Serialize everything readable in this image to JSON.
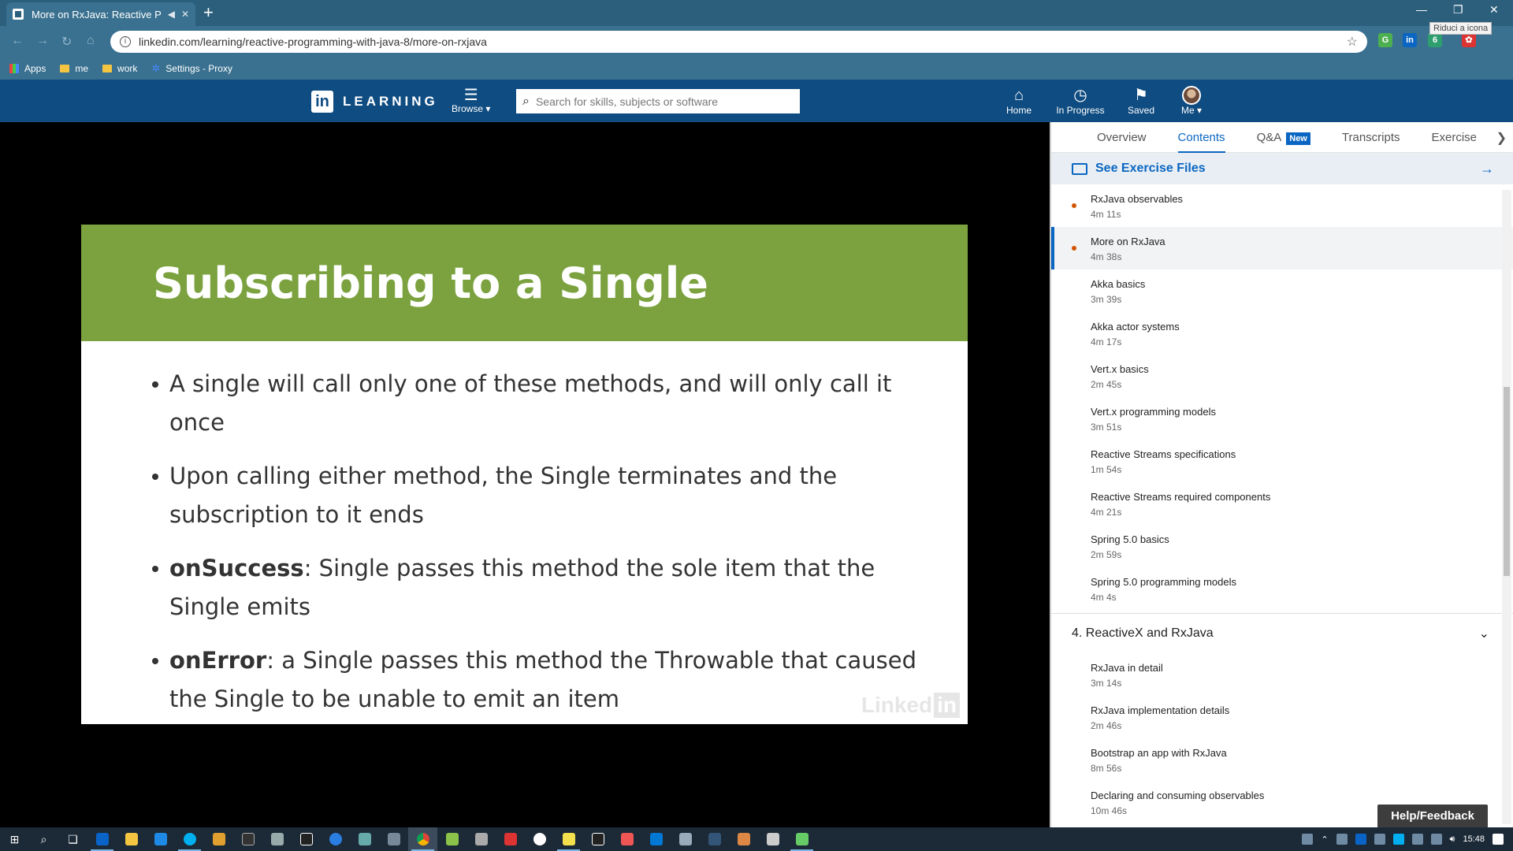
{
  "browser": {
    "tab_title": "More on RxJava: Reactive Pr",
    "address": "linkedin.com/learning/reactive-programming-with-java-8/more-on-rxjava",
    "tooltip": "Riduci a icona",
    "bookmarks": [
      {
        "label": "Apps",
        "icon": "apps-grid-icon"
      },
      {
        "label": "me",
        "icon": "folder-icon"
      },
      {
        "label": "work",
        "icon": "folder-icon"
      },
      {
        "label": "Settings - Proxy",
        "icon": "gear-icon"
      }
    ],
    "extension_badge": "6"
  },
  "header": {
    "logo_word": "LEARNING",
    "browse_label": "Browse",
    "search_placeholder": "Search for skills, subjects or software",
    "nav": [
      {
        "label": "Home",
        "icon": "home-icon"
      },
      {
        "label": "In Progress",
        "icon": "clock-icon"
      },
      {
        "label": "Saved",
        "icon": "bookmark-icon"
      },
      {
        "label": "Me",
        "icon": "avatar"
      }
    ]
  },
  "slide": {
    "title": "Subscribing to a Single",
    "bullets": [
      {
        "bold": "",
        "text": "A single will call only one of these methods, and will only call it once"
      },
      {
        "bold": "",
        "text": "Upon calling either method, the Single terminates and the subscription to it ends"
      },
      {
        "bold": "onSuccess",
        "text": ": Single passes this method the sole item that the Single emits"
      },
      {
        "bold": "onError",
        "text": ": a Single passes this method the Throwable that caused the Single to be unable to emit an item"
      }
    ],
    "watermark_left": "Linked",
    "watermark_box": "in"
  },
  "panel": {
    "tabs": [
      {
        "label": "Overview",
        "active": false
      },
      {
        "label": "Contents",
        "active": true
      },
      {
        "label": "Q&A",
        "active": false,
        "badge": "New"
      },
      {
        "label": "Transcripts",
        "active": false
      },
      {
        "label": "Exercise Files",
        "active": false
      }
    ],
    "exercise_link": "See Exercise Files",
    "videos": [
      {
        "title": "RxJava observables",
        "duration": "4m 11s",
        "viewed": true,
        "current": false
      },
      {
        "title": "More on RxJava",
        "duration": "4m 38s",
        "viewed": true,
        "current": true
      },
      {
        "title": "Akka basics",
        "duration": "3m 39s",
        "viewed": false,
        "current": false
      },
      {
        "title": "Akka actor systems",
        "duration": "4m 17s",
        "viewed": false,
        "current": false
      },
      {
        "title": "Vert.x basics",
        "duration": "2m 45s",
        "viewed": false,
        "current": false
      },
      {
        "title": "Vert.x programming models",
        "duration": "3m 51s",
        "viewed": false,
        "current": false
      },
      {
        "title": "Reactive Streams specifications",
        "duration": "1m 54s",
        "viewed": false,
        "current": false
      },
      {
        "title": "Reactive Streams required components",
        "duration": "4m 21s",
        "viewed": false,
        "current": false
      },
      {
        "title": "Spring 5.0 basics",
        "duration": "2m 59s",
        "viewed": false,
        "current": false
      },
      {
        "title": "Spring 5.0 programming models",
        "duration": "4m 4s",
        "viewed": false,
        "current": false
      }
    ],
    "chapter_title": "4. ReactiveX and RxJava",
    "chapter_videos": [
      {
        "title": "RxJava in detail",
        "duration": "3m 14s"
      },
      {
        "title": "RxJava implementation details",
        "duration": "2m 46s"
      },
      {
        "title": "Bootstrap an app with RxJava",
        "duration": "8m 56s"
      },
      {
        "title": "Declaring and consuming observables",
        "duration": "10m 46s"
      }
    ],
    "help_label": "Help/Feedback"
  },
  "taskbar": {
    "time": "15:48"
  }
}
